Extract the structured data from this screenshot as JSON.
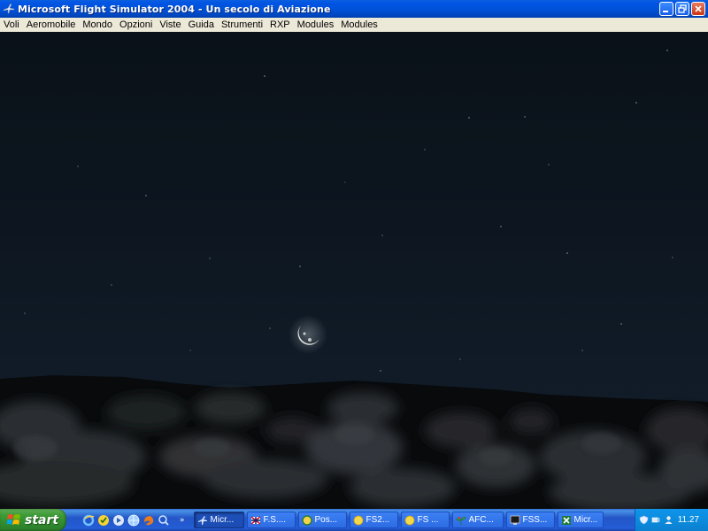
{
  "window": {
    "title": "Microsoft Flight Simulator 2004 - Un secolo di Aviazione"
  },
  "menu": {
    "items": [
      "Voli",
      "Aeromobile",
      "Mondo",
      "Opzioni",
      "Viste",
      "Guida",
      "Strumenti",
      "RXP",
      "Modules",
      "Modules"
    ]
  },
  "scene": {
    "description_icons": [
      "moon",
      "stars",
      "clouds"
    ]
  },
  "taskbar": {
    "start_label": "start",
    "quicklaunch_icons": [
      "ie-icon",
      "norton-icon",
      "media-player-icon",
      "globe-icon",
      "firefox-icon",
      "search-icon"
    ],
    "more_label": "»",
    "tasks": [
      {
        "label": "Micr...",
        "icon": "flightsim-icon",
        "active": true
      },
      {
        "label": "F.S....",
        "icon": "flag-icon",
        "active": false
      },
      {
        "label": "Pos...",
        "icon": "green-circle-icon",
        "active": false
      },
      {
        "label": "FS2...",
        "icon": "yellow-circle-icon",
        "active": false
      },
      {
        "label": "FS ...",
        "icon": "yellow-circle-icon",
        "active": false
      },
      {
        "label": "AFC...",
        "icon": "plant-icon",
        "active": false
      },
      {
        "label": "FSS...",
        "icon": "monitor-icon",
        "active": false
      },
      {
        "label": "Micr...",
        "icon": "excel-icon",
        "active": false
      }
    ],
    "tray_icons": [
      "shield-tray-icon",
      "network-tray-icon",
      "user-tray-icon"
    ],
    "clock": "11.27"
  }
}
